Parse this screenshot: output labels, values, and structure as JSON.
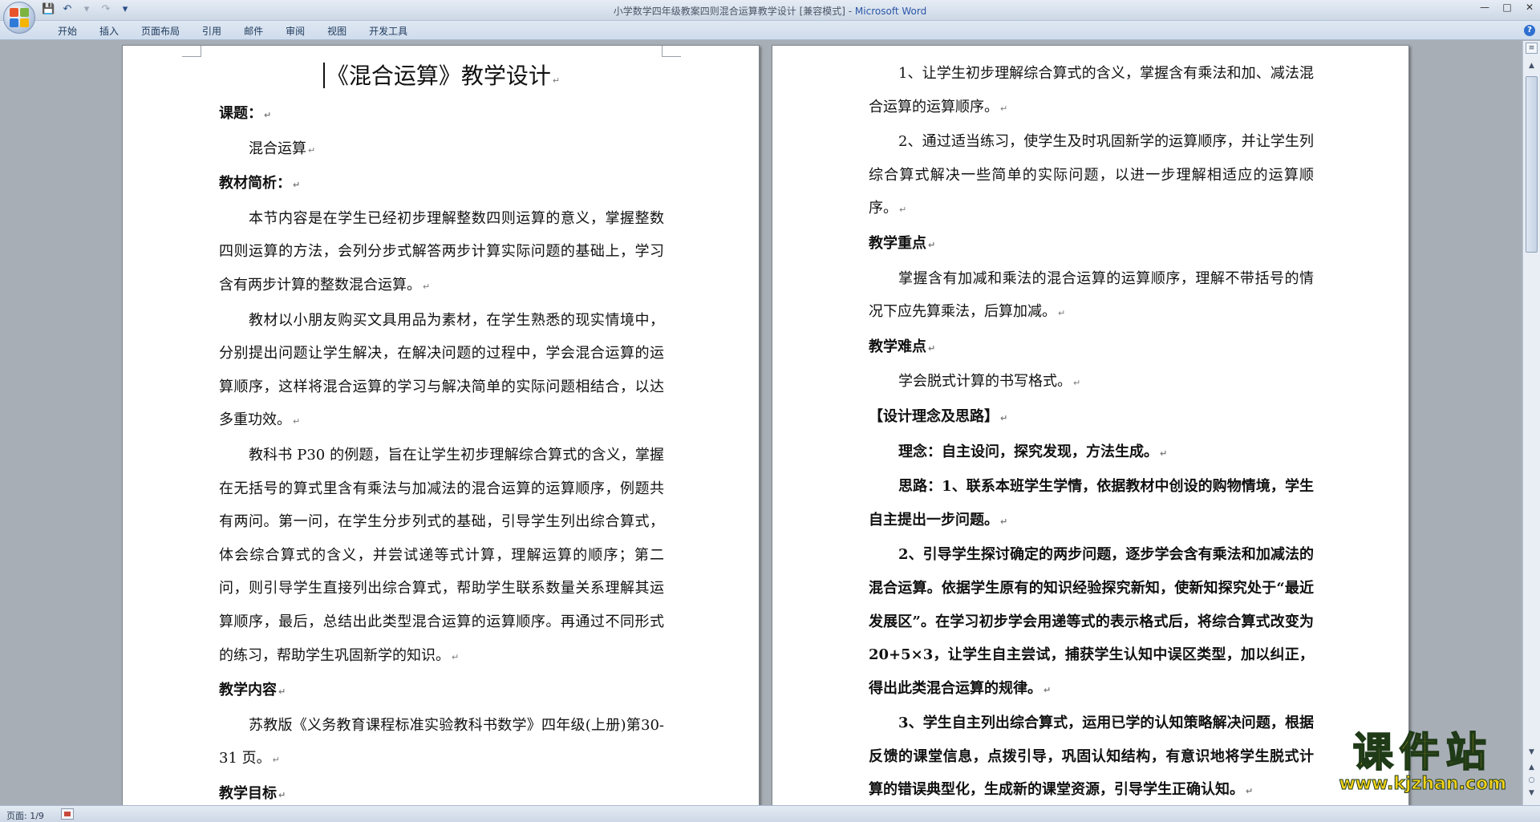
{
  "window": {
    "title": "小学数学四年级教案四则混合运算教学设计 [兼容模式] - ",
    "app_name": "Microsoft Word"
  },
  "ribbon": {
    "tabs": [
      "开始",
      "插入",
      "页面布局",
      "引用",
      "邮件",
      "审阅",
      "视图",
      "开发工具"
    ]
  },
  "document": {
    "title": "《混合运算》教学设计",
    "left_page": [
      {
        "text": "课题：",
        "bold": true,
        "indent": false
      },
      {
        "text": "混合运算",
        "bold": false,
        "indent": true
      },
      {
        "text": "教材简析：",
        "bold": true,
        "indent": false
      },
      {
        "text": "本节内容是在学生已经初步理解整数四则运算的意义，掌握整数四则运算的方法，会列分步式解答两步计算实际问题的基础上，学习含有两步计算的整数混合运算。",
        "bold": false,
        "indent": true
      },
      {
        "text": "教材以小朋友购买文具用品为素材，在学生熟悉的现实情境中，分别提出问题让学生解决，在解决问题的过程中，学会混合运算的运算顺序，这样将混合运算的学习与解决简单的实际问题相结合，以达多重功效。",
        "bold": false,
        "indent": true
      },
      {
        "text": "教科书 P30 的例题，旨在让学生初步理解综合算式的含义，掌握在无括号的算式里含有乘法与加减法的混合运算的运算顺序，例题共有两问。第一问，在学生分步列式的基础，引导学生列出综合算式，体会综合算式的含义，并尝试递等式计算，理解运算的顺序；第二问，则引导学生直接列出综合算式，帮助学生联系数量关系理解其运算顺序，最后，总结出此类型混合运算的运算顺序。再通过不同形式的练习，帮助学生巩固新学的知识。",
        "bold": false,
        "indent": true
      },
      {
        "text": "教学内容",
        "bold": true,
        "indent": false
      },
      {
        "text": "苏教版《义务教育课程标准实验教科书数学》四年级(上册)第30-31 页。",
        "bold": false,
        "indent": true
      },
      {
        "text": "教学目标",
        "bold": true,
        "indent": false
      }
    ],
    "right_page": [
      {
        "text": "1、让学生初步理解综合算式的含义，掌握含有乘法和加、减法混合运算的运算顺序。",
        "bold": false,
        "indent": true
      },
      {
        "text": "2、通过适当练习，使学生及时巩固新学的运算顺序，并让学生列综合算式解决一些简单的实际问题，以进一步理解相适应的运算顺序。",
        "bold": false,
        "indent": true
      },
      {
        "text": "教学重点",
        "bold": true,
        "indent": false
      },
      {
        "text": "掌握含有加减和乘法的混合运算的运算顺序，理解不带括号的情况下应先算乘法，后算加减。",
        "bold": false,
        "indent": true
      },
      {
        "text": "教学难点",
        "bold": true,
        "indent": false
      },
      {
        "text": "学会脱式计算的书写格式。",
        "bold": false,
        "indent": true
      },
      {
        "text": "【设计理念及思路】",
        "bold": true,
        "indent": false
      },
      {
        "text": "理念：自主设问，探究发现，方法生成。",
        "bold": true,
        "indent": true
      },
      {
        "text": "思路：1、联系本班学生学情，依据教材中创设的购物情境，学生自主提出一步问题。",
        "bold": true,
        "indent": true
      },
      {
        "text": "2、引导学生探讨确定的两步问题，逐步学会含有乘法和加减法的混合运算。依据学生原有的知识经验探究新知，使新知探究处于“最近发展区”。在学习初步学会用递等式的表示格式后，将综合算式改变为 20+5×3，让学生自主尝试，捕获学生认知中误区类型，加以纠正，得出此类混合运算的规律。",
        "bold": true,
        "indent": true
      },
      {
        "text": "3、学生自主列出综合算式，运用已学的认知策略解决问题，根据反馈的课堂信息，点拨引导，巩固认知结构，有意识地将学生脱式计算的错误典型化，生成新的课堂资源，引导学生正确认知。",
        "bold": true,
        "indent": true
      }
    ]
  },
  "status": {
    "page": "页面: 1/9"
  },
  "watermark": {
    "big": "课件站",
    "small": "www.kjzhan.com"
  },
  "icons": {
    "office_button": "office-logo-icon",
    "save": "save-icon",
    "undo": "undo-icon",
    "redo": "redo-icon",
    "help": "help-icon"
  },
  "colors": {
    "app_name": "#2b57a8",
    "workspace": "#a8aeb6",
    "watermark": "#f3d21a"
  }
}
